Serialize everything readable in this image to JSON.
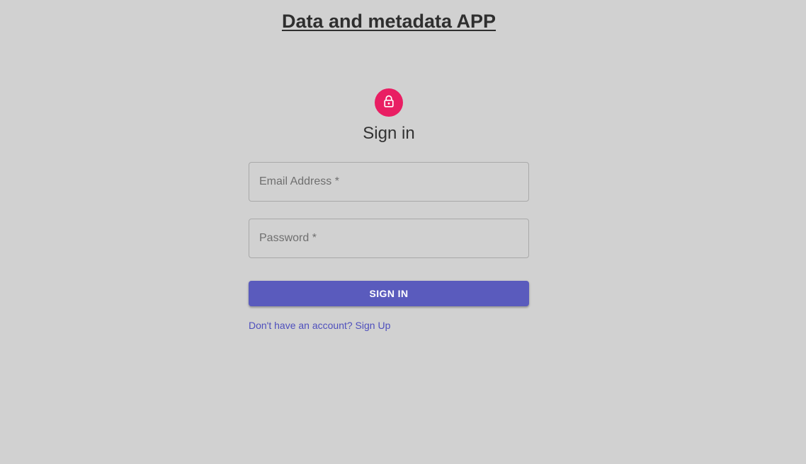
{
  "header": {
    "title": "Data and metadata APP"
  },
  "signin": {
    "avatar_icon": "lock-icon",
    "heading": "Sign in",
    "email": {
      "placeholder": "Email Address *",
      "value": ""
    },
    "password": {
      "placeholder": "Password *",
      "value": ""
    },
    "submit_label": "SIGN IN",
    "signup_link": "Don't have an account? Sign Up"
  },
  "colors": {
    "background": "#d1d1d1",
    "avatar": "#e91e63",
    "primary_button": "#5a5bbd",
    "link": "#4e4fbd"
  }
}
